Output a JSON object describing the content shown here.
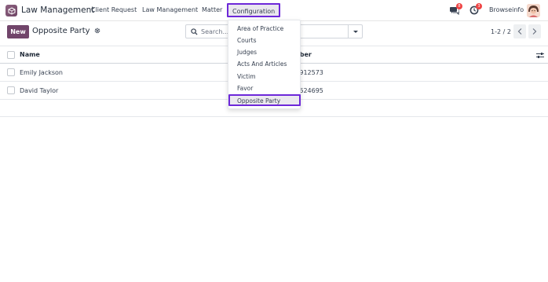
{
  "navbar": {
    "app_name": "Law Management",
    "menus": [
      "Client Request",
      "Law Management",
      "Matter",
      "Configuration"
    ],
    "messages_badge": "8",
    "activity_badge": "3",
    "company": "Browseinfo"
  },
  "control_panel": {
    "new_label": "New",
    "breadcrumb": "Opposite Party",
    "search_placeholder": "Search...",
    "pager": "1-2 / 2"
  },
  "list": {
    "columns": [
      "Name",
      "Number"
    ],
    "rows": [
      {
        "name": "Emily Jackson",
        "number": "8655912573"
      },
      {
        "name": "David Taylor",
        "number": "7837624695"
      }
    ]
  },
  "dropdown": {
    "items": [
      "Area of Practice",
      "Courts",
      "Judges",
      "Acts And Articles",
      "Victim",
      "Favor",
      "Opposite Party"
    ],
    "selected": "Opposite Party"
  },
  "colors": {
    "brand": "#71456a",
    "highlight_border": "#6d28d9",
    "badge": "#ef4444"
  }
}
